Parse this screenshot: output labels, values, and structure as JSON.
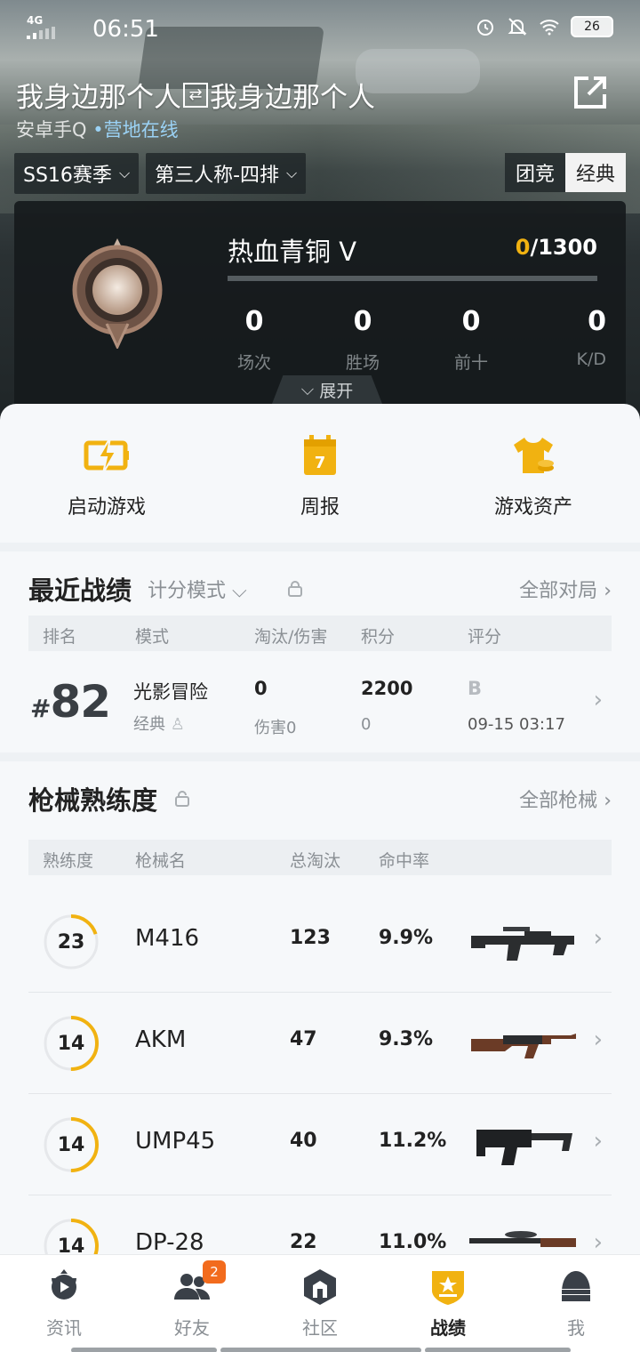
{
  "status_bar": {
    "network": "4G",
    "time": "06:51",
    "battery": "26"
  },
  "profile": {
    "name": "我身边那个人",
    "alt_name": "我身边那个人",
    "platform": "安卓手Q",
    "online_status": "营地在线"
  },
  "filters": {
    "season": "SS16赛季",
    "perspective": "第三人称-四排",
    "mode_team": "团竞",
    "mode_classic": "经典"
  },
  "rank": {
    "title": "热血青铜 V",
    "score_current": "0",
    "score_total": "/1300",
    "progress": 0,
    "stats": [
      {
        "value": "0",
        "label": "场次"
      },
      {
        "value": "0",
        "label": "胜场"
      },
      {
        "value": "0",
        "label": "前十"
      },
      {
        "value": "0",
        "label": "K/D"
      }
    ],
    "expand_label": "展开"
  },
  "quick_actions": [
    {
      "label": "启动游戏",
      "icon": "lightning-icon"
    },
    {
      "label": "周报",
      "icon": "calendar-icon",
      "day": "7"
    },
    {
      "label": "游戏资产",
      "icon": "shirt-coins-icon"
    }
  ],
  "recent": {
    "title": "最近战绩",
    "mode_filter": "计分模式",
    "link": "全部对局",
    "headers": [
      "排名",
      "模式",
      "淘汰/伤害",
      "积分",
      "评分"
    ],
    "match": {
      "rank_hash": "#",
      "rank": "82",
      "mode": "光影冒险",
      "sub_mode": "经典",
      "kills": "0",
      "damage": "伤害0",
      "points": "2200",
      "points_sub": "0",
      "grade": "B",
      "time": "09-15 03:17"
    }
  },
  "weapons": {
    "title": "枪械熟练度",
    "link": "全部枪械",
    "headers": [
      "熟练度",
      "枪械名",
      "总淘汰",
      "命中率"
    ],
    "rows": [
      {
        "level": "23",
        "level_progress": 0.2,
        "name": "M416",
        "kills": "123",
        "accuracy": "9.9%"
      },
      {
        "level": "14",
        "level_progress": 0.5,
        "name": "AKM",
        "kills": "47",
        "accuracy": "9.3%"
      },
      {
        "level": "14",
        "level_progress": 0.5,
        "name": "UMP45",
        "kills": "40",
        "accuracy": "11.2%"
      },
      {
        "level": "14",
        "level_progress": 0.5,
        "name": "DP-28",
        "kills": "22",
        "accuracy": "11.0%"
      }
    ]
  },
  "tabs": [
    {
      "label": "资讯"
    },
    {
      "label": "好友",
      "badge": "2"
    },
    {
      "label": "社区"
    },
    {
      "label": "战绩"
    },
    {
      "label": "我"
    }
  ],
  "colors": {
    "accent": "#f1b211",
    "badge": "#f26b1d",
    "online": "#9bd2f5"
  }
}
